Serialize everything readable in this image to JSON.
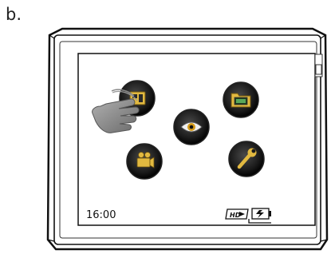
{
  "figure_label": "b.",
  "status": {
    "time": "16:00"
  },
  "icons": {
    "photo_mode": "photo-mode-icon",
    "gallery": "folder-gallery-icon",
    "view": "eye-icon",
    "video_mode": "video-camera-icon",
    "settings": "wrench-icon",
    "hd": "hd-icon",
    "charging": "battery-charging-icon",
    "touch_hand": "touch-hand-icon"
  }
}
